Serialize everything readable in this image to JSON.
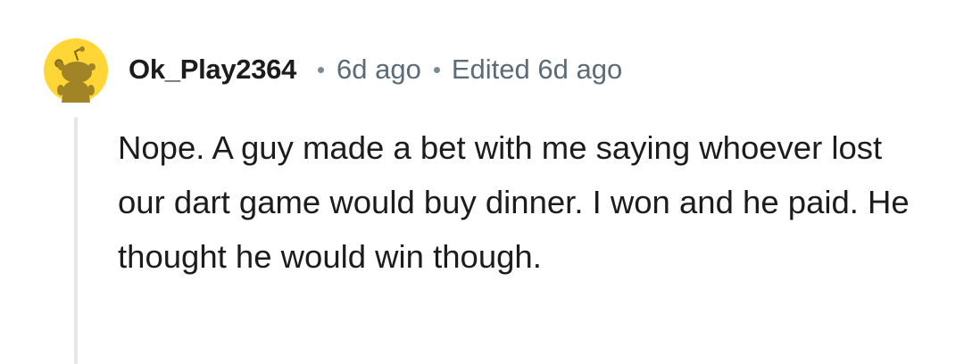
{
  "comment": {
    "username": "Ok_Play2364",
    "time": "6d ago",
    "edited": "Edited 6d ago",
    "body": "Nope. A guy made a bet with me saying whoever lost our dart game would buy dinner. I won and he paid. He thought he would win though.",
    "avatar": {
      "icon": "reddit-snoo-icon",
      "background_color": "#FFD635",
      "figure_color": "#A08425"
    }
  }
}
